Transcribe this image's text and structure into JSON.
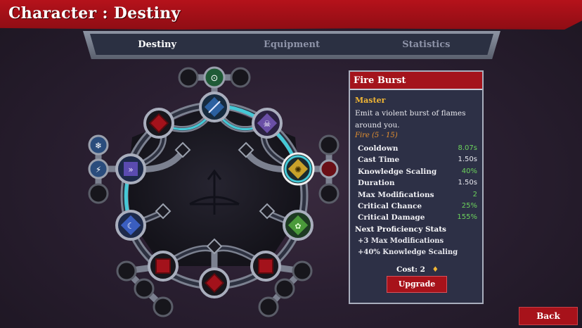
{
  "header": {
    "title": "Character : Destiny"
  },
  "tabs": [
    {
      "label": "Destiny",
      "active": true
    },
    {
      "label": "Equipment",
      "active": false
    },
    {
      "label": "Statistics",
      "active": false
    }
  ],
  "skill_panel": {
    "name": "Fire Burst",
    "rank": "Master",
    "description": "Emit a violent burst of flames around you.",
    "element": "Fire  (5 - 15)",
    "stats": [
      {
        "name": "Cooldown",
        "value": "8.07s",
        "highlight": true
      },
      {
        "name": "Cast Time",
        "value": "1.50s",
        "highlight": false
      },
      {
        "name": "Knowledge Scaling",
        "value": "40%",
        "highlight": true
      },
      {
        "name": "Duration",
        "value": "1.50s",
        "highlight": false
      },
      {
        "name": "Max Modifications",
        "value": "2",
        "highlight": true
      },
      {
        "name": "Critical Chance",
        "value": "25%",
        "highlight": true
      },
      {
        "name": "Critical Damage",
        "value": "155%",
        "highlight": true
      }
    ],
    "next_title": "Next Proficiency Stats",
    "next_items": [
      "+3 Max Modifications",
      "+40% Knowledge Scaling"
    ],
    "cost_label": "Cost:",
    "cost_value": "2",
    "upgrade_label": "Upgrade"
  },
  "back_label": "Back",
  "colors": {
    "accent_red": "#a7121a",
    "cyan_ring": "#45c8d6",
    "stat_green": "#6cd35c",
    "rank_gold": "#f2b735",
    "element_orange": "#e8922f"
  },
  "tree_nodes": [
    {
      "id": "node-top",
      "icon": "bow-arrow-icon",
      "state": "unlocked"
    },
    {
      "id": "node-upper-left",
      "icon": "red-diamond-icon",
      "state": "locked"
    },
    {
      "id": "node-upper-right",
      "icon": "demon-mask-icon",
      "state": "unlocked"
    },
    {
      "id": "node-left",
      "icon": "arrow-barrage-icon",
      "state": "unlocked"
    },
    {
      "id": "node-right",
      "icon": "fire-burst-icon",
      "state": "selected"
    },
    {
      "id": "node-lower-left",
      "icon": "moon-swirl-icon",
      "state": "unlocked"
    },
    {
      "id": "node-lower-right",
      "icon": "green-leaf-icon",
      "state": "unlocked"
    },
    {
      "id": "node-bottom-left",
      "icon": "red-square-icon",
      "state": "locked"
    },
    {
      "id": "node-bottom",
      "icon": "red-diamond-icon",
      "state": "locked"
    },
    {
      "id": "node-bottom-right",
      "icon": "red-square-icon",
      "state": "locked"
    }
  ]
}
